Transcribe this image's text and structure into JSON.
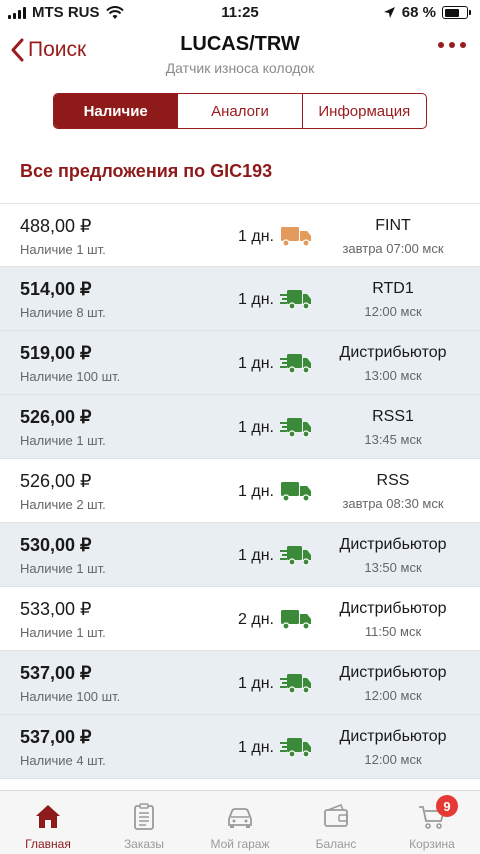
{
  "status": {
    "carrier": "MTS RUS",
    "time": "11:25",
    "battery": "68 %",
    "battery_level": 0.68
  },
  "nav": {
    "back_label": "Поиск",
    "title": "LUCAS/TRW",
    "subtitle": "Датчик износа колодок"
  },
  "tabs": [
    "Наличие",
    "Аналоги",
    "Информация"
  ],
  "active_tab": 0,
  "section_title": "Все предложения по GIC193",
  "colors": {
    "accent": "#8f1a1a",
    "truck_green": "#3a8a3a",
    "truck_orange": "#e39a5a",
    "badge": "#e53935"
  },
  "offers": [
    {
      "price": "488,00 ₽",
      "stock": "Наличие 1 шт.",
      "days": "1 дн.",
      "supplier": "FINT",
      "time": "завтра 07:00 мск",
      "truck_icon": "truck-orange-icon",
      "fast": false,
      "highlighted": false
    },
    {
      "price": "514,00 ₽",
      "stock": "Наличие 8 шт.",
      "days": "1 дн.",
      "supplier": "RTD1",
      "time": "12:00 мск",
      "truck_icon": "fast-truck-green-icon",
      "fast": true,
      "highlighted": true
    },
    {
      "price": "519,00 ₽",
      "stock": "Наличие 100 шт.",
      "days": "1 дн.",
      "supplier": "Дистрибьютор",
      "time": "13:00 мск",
      "truck_icon": "fast-truck-green-icon",
      "fast": true,
      "highlighted": true
    },
    {
      "price": "526,00 ₽",
      "stock": "Наличие 1 шт.",
      "days": "1 дн.",
      "supplier": "RSS1",
      "time": "13:45 мск",
      "truck_icon": "fast-truck-green-icon",
      "fast": true,
      "highlighted": true
    },
    {
      "price": "526,00 ₽",
      "stock": "Наличие 2 шт.",
      "days": "1 дн.",
      "supplier": "RSS",
      "time": "завтра 08:30 мск",
      "truck_icon": "truck-green-icon",
      "fast": false,
      "highlighted": false
    },
    {
      "price": "530,00 ₽",
      "stock": "Наличие 1 шт.",
      "days": "1 дн.",
      "supplier": "Дистрибьютор",
      "time": "13:50 мск",
      "truck_icon": "fast-truck-green-icon",
      "fast": true,
      "highlighted": true
    },
    {
      "price": "533,00 ₽",
      "stock": "Наличие 1 шт.",
      "days": "2 дн.",
      "supplier": "Дистрибьютор",
      "time": "11:50 мск",
      "truck_icon": "truck-green-icon",
      "fast": false,
      "highlighted": false
    },
    {
      "price": "537,00 ₽",
      "stock": "Наличие 100 шт.",
      "days": "1 дн.",
      "supplier": "Дистрибьютор",
      "time": "12:00 мск",
      "truck_icon": "fast-truck-green-icon",
      "fast": true,
      "highlighted": true
    },
    {
      "price": "537,00 ₽",
      "stock": "Наличие 4 шт.",
      "days": "1 дн.",
      "supplier": "Дистрибьютор",
      "time": "12:00 мск",
      "truck_icon": "fast-truck-green-icon",
      "fast": true,
      "highlighted": true
    }
  ],
  "tabbar": [
    {
      "label": "Главная",
      "icon": "home-icon",
      "active": true
    },
    {
      "label": "Заказы",
      "icon": "clipboard-icon",
      "active": false
    },
    {
      "label": "Мой гараж",
      "icon": "car-icon",
      "active": false
    },
    {
      "label": "Баланс",
      "icon": "wallet-icon",
      "active": false
    },
    {
      "label": "Корзина",
      "icon": "cart-icon",
      "active": false,
      "badge": "9"
    }
  ]
}
